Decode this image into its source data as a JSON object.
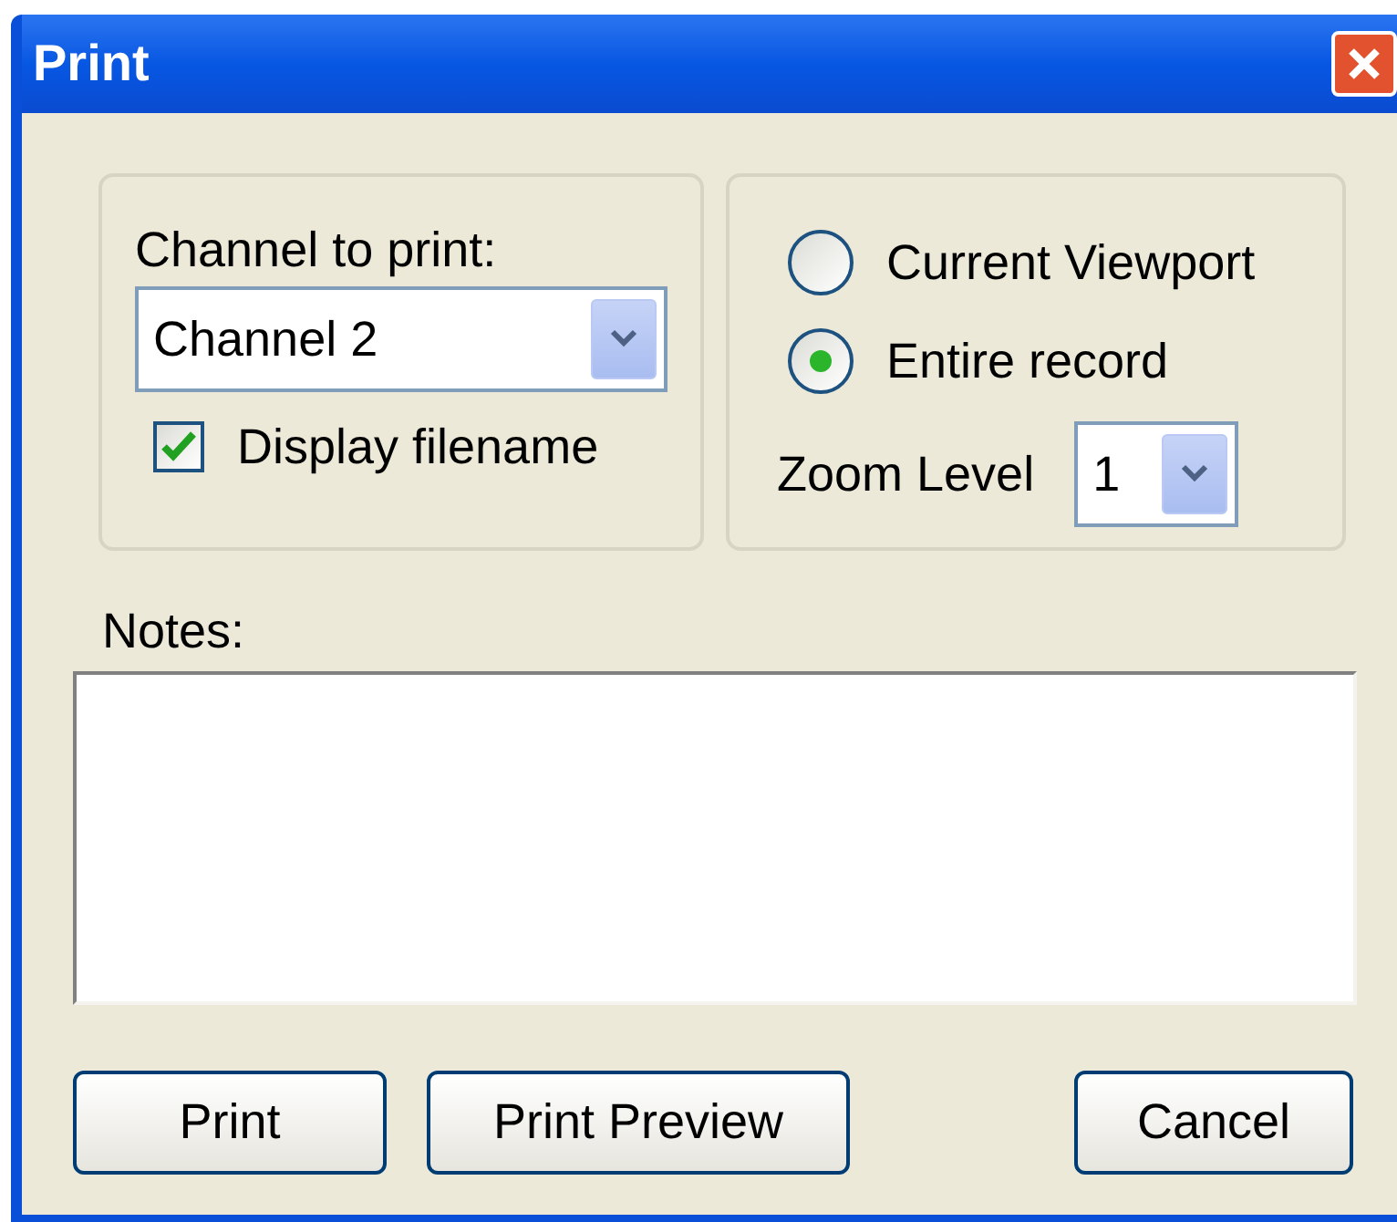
{
  "window": {
    "title": "Print"
  },
  "channel": {
    "label": "Channel to print:",
    "value": "Channel 2",
    "display_filename": {
      "label": "Display filename",
      "checked": true
    }
  },
  "range": {
    "options": [
      {
        "label": "Current Viewport",
        "selected": false
      },
      {
        "label": "Entire record",
        "selected": true
      }
    ],
    "zoom": {
      "label": "Zoom Level",
      "value": "1"
    }
  },
  "notes": {
    "label": "Notes:"
  },
  "buttons": [
    "Print",
    "Print Preview",
    "Cancel"
  ]
}
